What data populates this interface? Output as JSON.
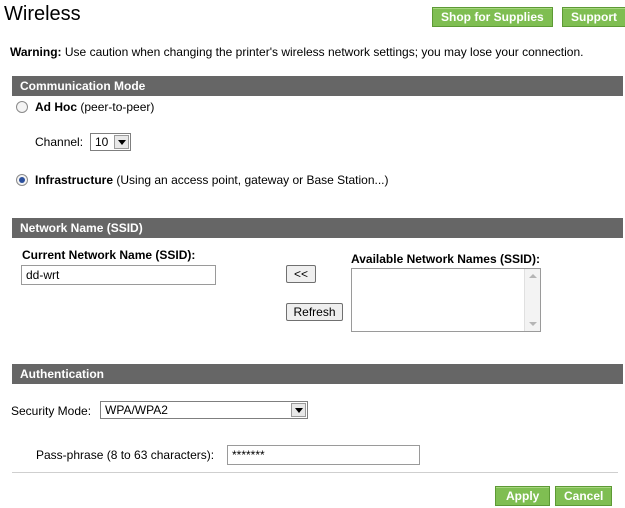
{
  "header": {
    "title": "Wireless",
    "shop_label": "Shop for Supplies",
    "support_label": "Support"
  },
  "warning": {
    "label": "Warning:",
    "text": "Use caution when changing the printer's wireless network settings; you may lose your connection."
  },
  "communication_mode": {
    "title": "Communication Mode",
    "adhoc": {
      "label": "Ad Hoc",
      "desc": "(peer-to-peer)",
      "selected": false
    },
    "channel": {
      "label": "Channel:",
      "value": "10"
    },
    "infrastructure": {
      "label": "Infrastructure",
      "desc": "(Using an access point, gateway or Base Station...)",
      "selected": true
    }
  },
  "network_name": {
    "title": "Network Name (SSID)",
    "current_label": "Current Network Name (SSID):",
    "current_value": "dd-wrt",
    "move_label": "<<",
    "refresh_label": "Refresh",
    "available_label": "Available Network Names (SSID):",
    "available_items": []
  },
  "authentication": {
    "title": "Authentication",
    "security_label": "Security Mode:",
    "security_value": "WPA/WPA2",
    "passphrase_label": "Pass-phrase (8 to 63 characters):",
    "passphrase_value": "*******"
  },
  "footer": {
    "apply_label": "Apply",
    "cancel_label": "Cancel"
  },
  "colors": {
    "section_bar": "#666666",
    "green_button": "#7fbe52"
  }
}
